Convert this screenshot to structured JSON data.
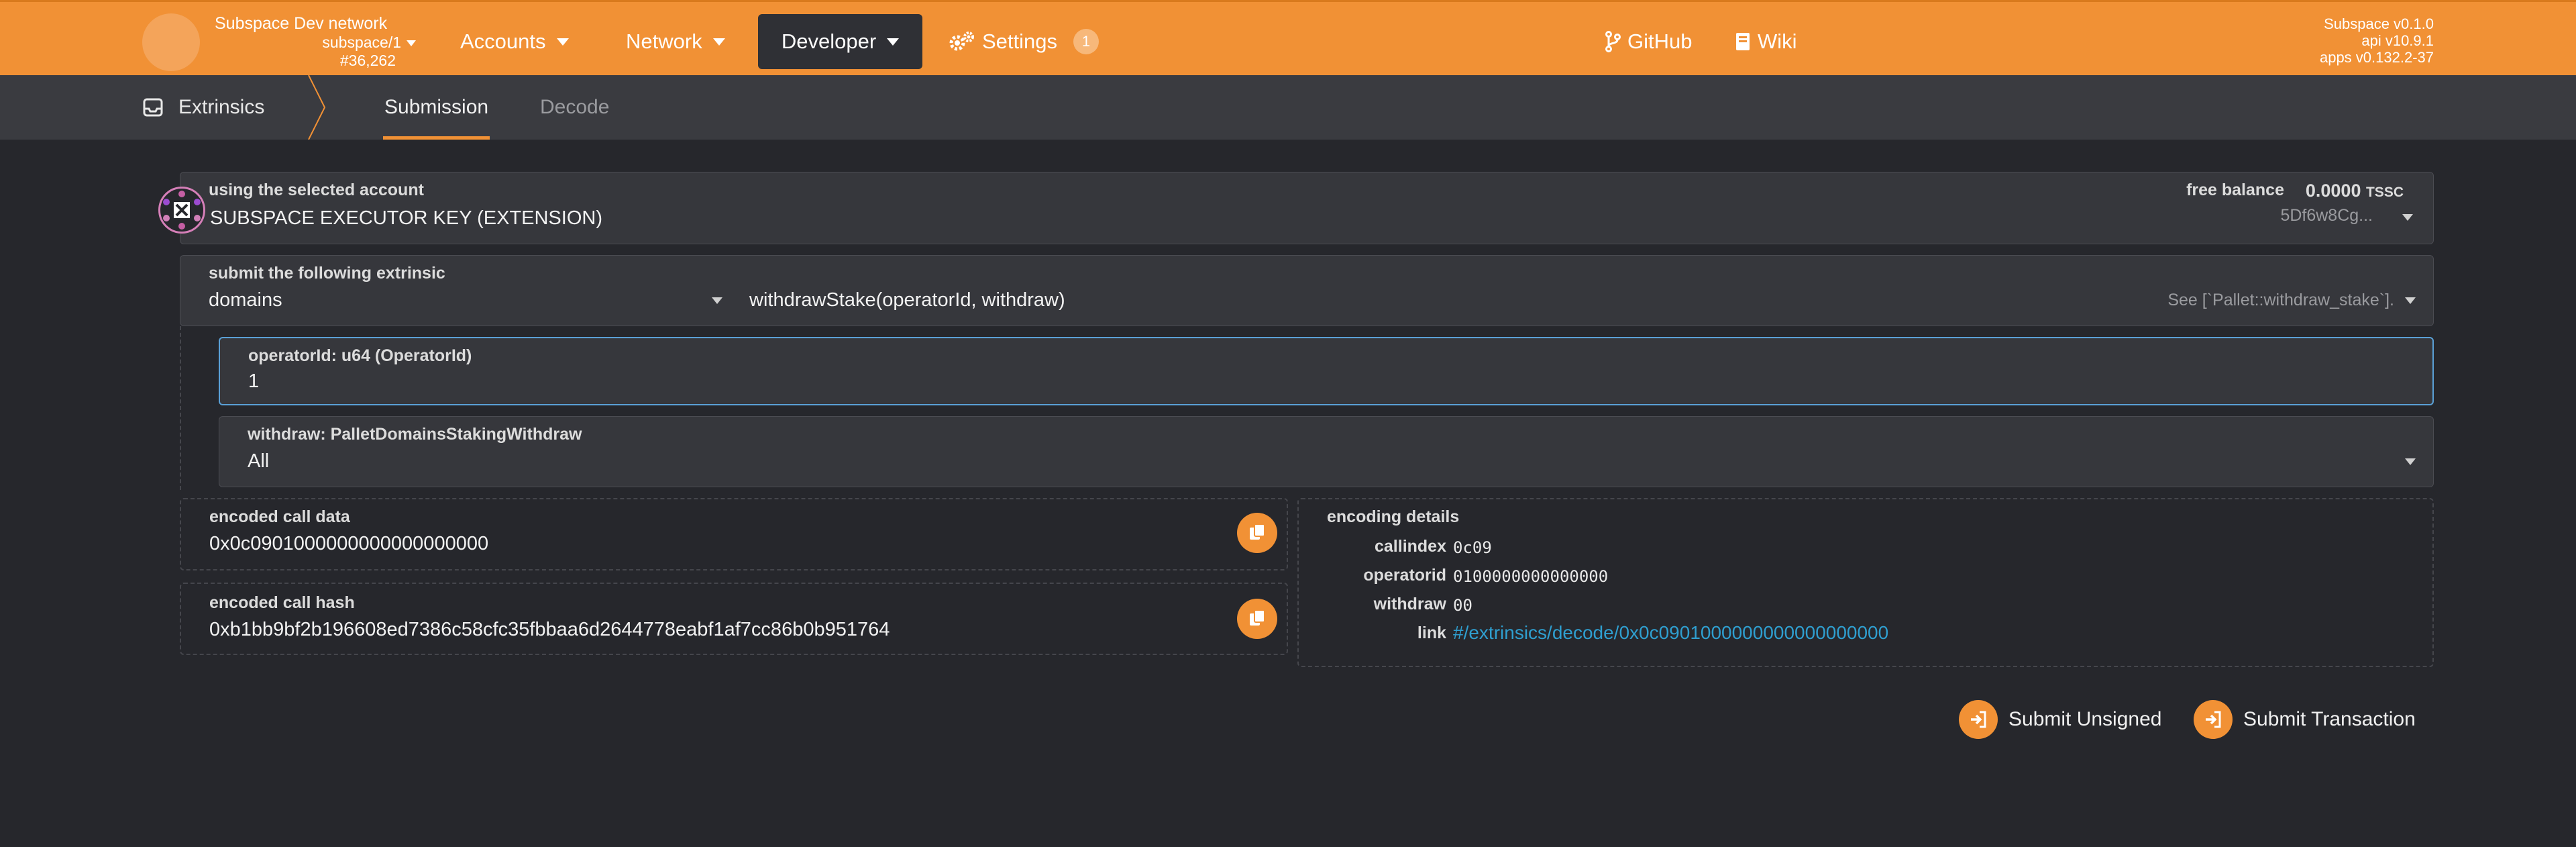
{
  "header": {
    "network_name": "Subspace Dev network",
    "chain": "subspace/1",
    "block": "#36,262",
    "nav": {
      "accounts": "Accounts",
      "network": "Network",
      "developer": "Developer",
      "settings": "Settings",
      "settings_badge": "1",
      "github": "GitHub",
      "wiki": "Wiki"
    },
    "versions": {
      "runtime": "Subspace v0.1.0",
      "api": "api v10.9.1",
      "apps": "apps v0.132.2-37"
    }
  },
  "subnav": {
    "title": "Extrinsics",
    "tabs": [
      {
        "label": "Submission",
        "active": true
      },
      {
        "label": "Decode",
        "active": false
      }
    ]
  },
  "account": {
    "label": "using the selected account",
    "name": "SUBSPACE EXECUTOR KEY (EXTENSION)",
    "balance_label": "free balance",
    "balance_value": "0.0000",
    "balance_unit": "TSSC",
    "address": "5Df6w8Cg..."
  },
  "extrinsic": {
    "label": "submit the following extrinsic",
    "pallet": "domains",
    "method": "withdrawStake(operatorId, withdraw)",
    "doc": "See [`Pallet::withdraw_stake`]."
  },
  "params": [
    {
      "label": "operatorId: u64 (OperatorId)",
      "value": "1"
    },
    {
      "label": "withdraw: PalletDomainsStakingWithdraw",
      "value": "All"
    }
  ],
  "encoded_call_data": {
    "label": "encoded call data",
    "value": "0x0c0901000000000000000000"
  },
  "encoded_call_hash": {
    "label": "encoded call hash",
    "value": "0xb1bb9bf2b196608ed7386c58cfc35fbbaa6d2644778eabf1af7cc86b0b951764"
  },
  "encoding_details": {
    "label": "encoding details",
    "rows": [
      {
        "key": "callindex",
        "value": "0c09"
      },
      {
        "key": "operatorid",
        "value": "0100000000000000"
      },
      {
        "key": "withdraw",
        "value": "00"
      }
    ],
    "link_key": "link",
    "link_value": "#/extrinsics/decode/0x0c0901000000000000000000"
  },
  "actions": {
    "submit_unsigned": "Submit Unsigned",
    "submit_transaction": "Submit Transaction"
  },
  "colors": {
    "accent": "#f19135",
    "background": "#26272c",
    "panel": "#36373c",
    "link": "#2f9fd0"
  }
}
